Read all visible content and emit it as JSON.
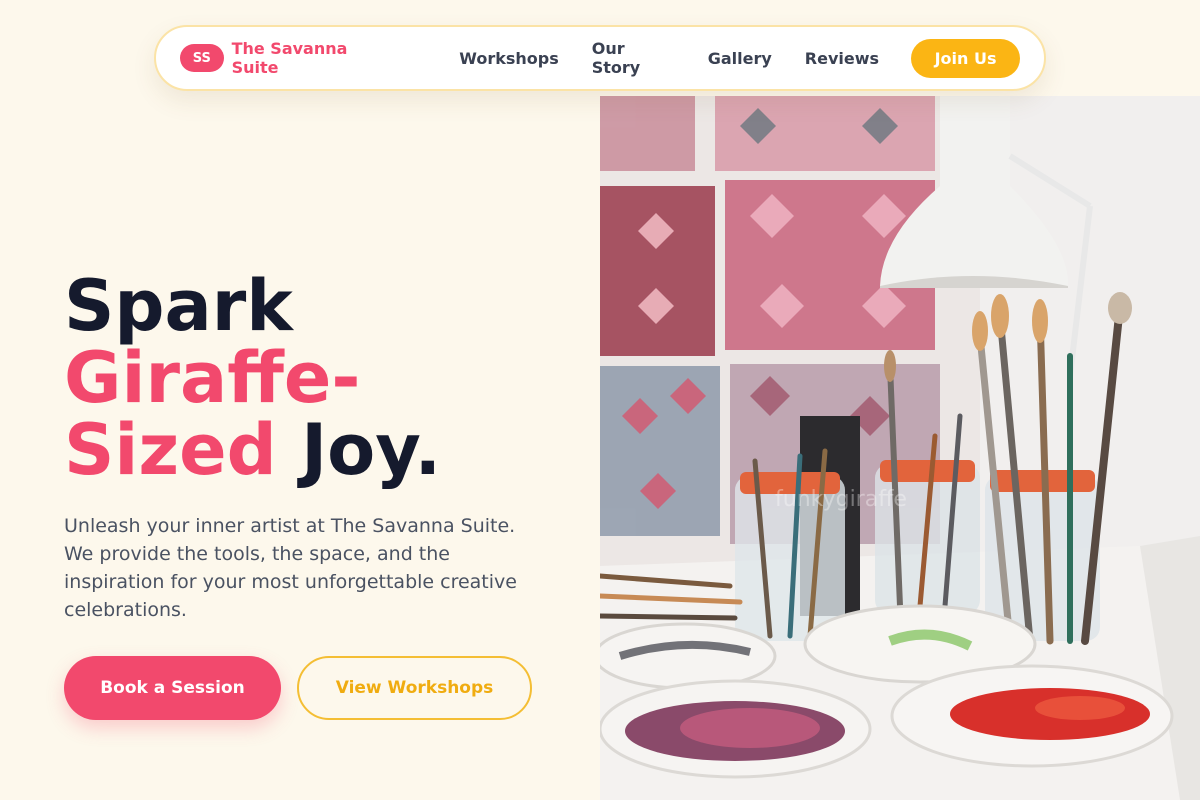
{
  "nav": {
    "logo_initials": "SS",
    "brand_name": "The Savanna Suite",
    "links": [
      {
        "label": "Workshops"
      },
      {
        "label": "Our Story"
      },
      {
        "label": "Gallery"
      },
      {
        "label": "Reviews"
      }
    ],
    "cta_label": "Join Us"
  },
  "hero": {
    "headline_line1": "Spark",
    "headline_highlight_1": "Giraffe-",
    "headline_highlight_2": "Sized",
    "headline_end": " Joy.",
    "lead": "Unleash your inner artist at The Savanna Suite. We provide the tools, the space, and the inspiration for your most unforgettable creative celebrations.",
    "primary_cta": "Book a Session",
    "secondary_cta": "View Workshops",
    "image_watermark": "funkygiraffe"
  },
  "colors": {
    "background": "#fdf8ec",
    "brand_pink": "#f2496d",
    "accent_yellow": "#fbb514",
    "text_dark": "#151a2d",
    "text_muted": "#4a5262"
  },
  "image": {
    "description_icon": "paint-brushes-photo"
  }
}
